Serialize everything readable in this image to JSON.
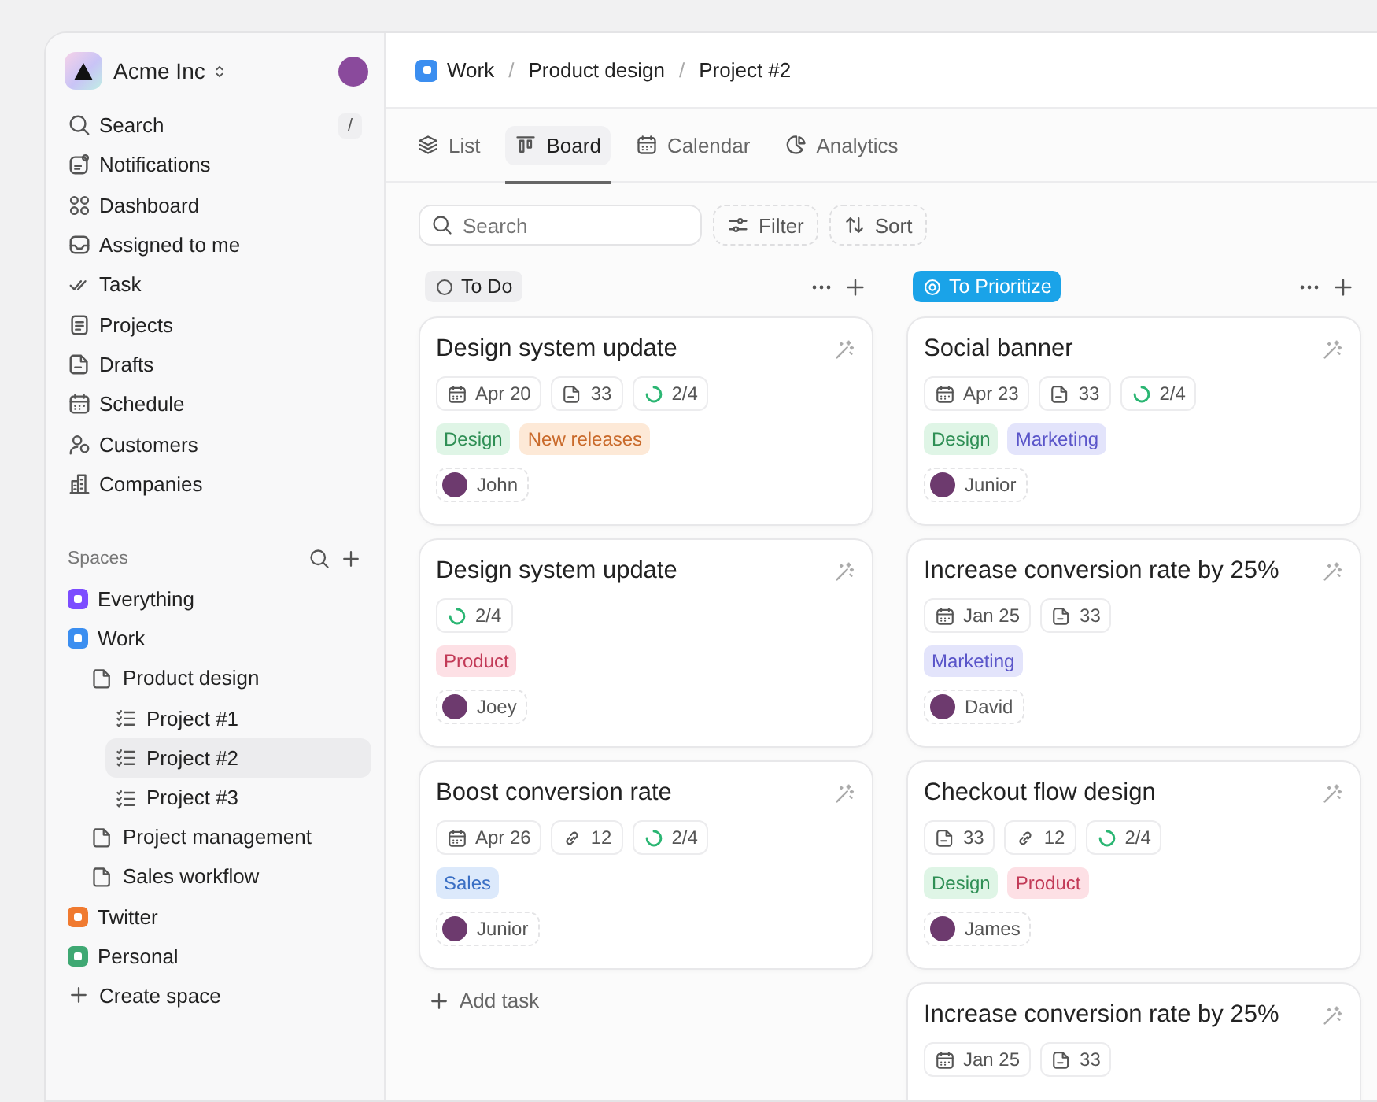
{
  "workspace": {
    "name": "Acme Inc"
  },
  "nav": [
    {
      "label": "Search",
      "shortcut": "/"
    },
    {
      "label": "Notifications"
    },
    {
      "label": "Dashboard"
    },
    {
      "label": "Assigned to me"
    },
    {
      "label": "Task"
    },
    {
      "label": "Projects"
    },
    {
      "label": "Drafts"
    },
    {
      "label": "Schedule"
    },
    {
      "label": "Customers"
    },
    {
      "label": "Companies"
    }
  ],
  "spaces": {
    "title": "Spaces",
    "create_label": "Create space",
    "items": [
      {
        "kind": "space",
        "label": "Everything",
        "color": "#7c4dff",
        "selected": false
      },
      {
        "kind": "space",
        "label": "Work",
        "color": "#3b8ef0",
        "selected": false,
        "children": [
          {
            "kind": "folder",
            "label": "Product design",
            "selected": false,
            "children": [
              {
                "kind": "list",
                "label": "Project #1",
                "selected": false
              },
              {
                "kind": "list",
                "label": "Project #2",
                "selected": true
              },
              {
                "kind": "list",
                "label": "Project #3",
                "selected": false
              }
            ]
          },
          {
            "kind": "folder",
            "label": "Project management",
            "selected": false
          },
          {
            "kind": "folder",
            "label": "Sales workflow",
            "selected": false
          }
        ]
      },
      {
        "kind": "space",
        "label": "Twitter",
        "color": "#f07a30",
        "selected": false
      },
      {
        "kind": "space",
        "label": "Personal",
        "color": "#3fa873",
        "selected": false
      }
    ]
  },
  "breadcrumb": {
    "separator": "/",
    "items": [
      "Work",
      "Product design",
      "Project #2"
    ]
  },
  "tabs": [
    {
      "label": "List",
      "selected": false
    },
    {
      "label": "Board",
      "selected": true
    },
    {
      "label": "Calendar",
      "selected": false
    },
    {
      "label": "Analytics",
      "selected": false
    }
  ],
  "toolbar": {
    "search": {
      "placeholder": "Search"
    },
    "filter": "Filter",
    "sort": "Sort"
  },
  "columns": [
    {
      "title": "To Do",
      "kind": "plain",
      "add_task": "Add task",
      "cards": [
        {
          "title": "Design system update",
          "chips": [
            {
              "kind": "date",
              "text": "Apr 20"
            },
            {
              "kind": "files",
              "text": "33"
            },
            {
              "kind": "progress",
              "text": "2/4"
            }
          ],
          "tags": [
            {
              "label": "Design",
              "color": "#dff5e6"
            },
            {
              "label": "New releases",
              "color": "#fde9d7"
            }
          ],
          "assignee": "John"
        },
        {
          "title": "Design system update",
          "chips": [
            {
              "kind": "progress",
              "text": "2/4"
            }
          ],
          "tags": [
            {
              "label": "Product",
              "color": "#fde0e5"
            }
          ],
          "assignee": "Joey"
        },
        {
          "title": "Boost conversion rate",
          "chips": [
            {
              "kind": "date",
              "text": "Apr 26"
            },
            {
              "kind": "links",
              "text": "12"
            },
            {
              "kind": "progress",
              "text": "2/4"
            }
          ],
          "tags": [
            {
              "label": "Sales",
              "color": "#dce9fb"
            }
          ],
          "assignee": "Junior"
        }
      ]
    },
    {
      "title": "To Prioritize",
      "kind": "accent",
      "cards": [
        {
          "title": "Social banner",
          "chips": [
            {
              "kind": "date",
              "text": "Apr 23"
            },
            {
              "kind": "files",
              "text": "33"
            },
            {
              "kind": "progress",
              "text": "2/4"
            }
          ],
          "tags": [
            {
              "label": "Design",
              "color": "#dff5e6"
            },
            {
              "label": "Marketing",
              "color": "#e3e4fb"
            }
          ],
          "assignee": "Junior"
        },
        {
          "title": "Increase conversion rate by 25%",
          "chips": [
            {
              "kind": "date",
              "text": "Jan 25"
            },
            {
              "kind": "files",
              "text": "33"
            }
          ],
          "tags": [
            {
              "label": "Marketing",
              "color": "#e3e4fb"
            }
          ],
          "assignee": "David"
        },
        {
          "title": "Checkout flow design",
          "chips": [
            {
              "kind": "files",
              "text": "33"
            },
            {
              "kind": "links",
              "text": "12"
            },
            {
              "kind": "progress",
              "text": "2/4"
            }
          ],
          "tags": [
            {
              "label": "Design",
              "color": "#dff5e6"
            },
            {
              "label": "Product",
              "color": "#fde0e5"
            }
          ],
          "assignee": "James"
        },
        {
          "title": "Increase conversion rate by 25%",
          "chips": [
            {
              "kind": "date",
              "text": "Jan 25"
            },
            {
              "kind": "files",
              "text": "33"
            }
          ]
        }
      ]
    }
  ]
}
